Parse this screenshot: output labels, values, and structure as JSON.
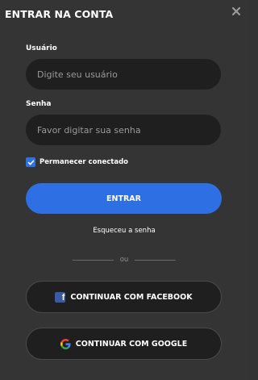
{
  "modal": {
    "title": "ENTRAR NA CONTA",
    "close_icon": "close-icon"
  },
  "form": {
    "username_label": "Usuário",
    "username_placeholder": "Digite seu usuário",
    "username_value": "",
    "password_label": "Senha",
    "password_placeholder": "Favor digitar sua senha",
    "password_value": "",
    "remember_label": "Permanecer conectado",
    "remember_checked": true,
    "submit_label": "ENTRAR",
    "forgot_label": "Esqueceu a senha"
  },
  "divider": {
    "label": "ou"
  },
  "social": {
    "facebook_label": "CONTINUAR COM FACEBOOK",
    "facebook_icon": "facebook-icon",
    "google_label": "CONTINUAR COM GOOGLE",
    "google_icon": "google-icon"
  },
  "colors": {
    "background": "#343434",
    "input_bg": "#1f1f1f",
    "primary": "#2e6fe3",
    "facebook": "#3b5aa3"
  }
}
